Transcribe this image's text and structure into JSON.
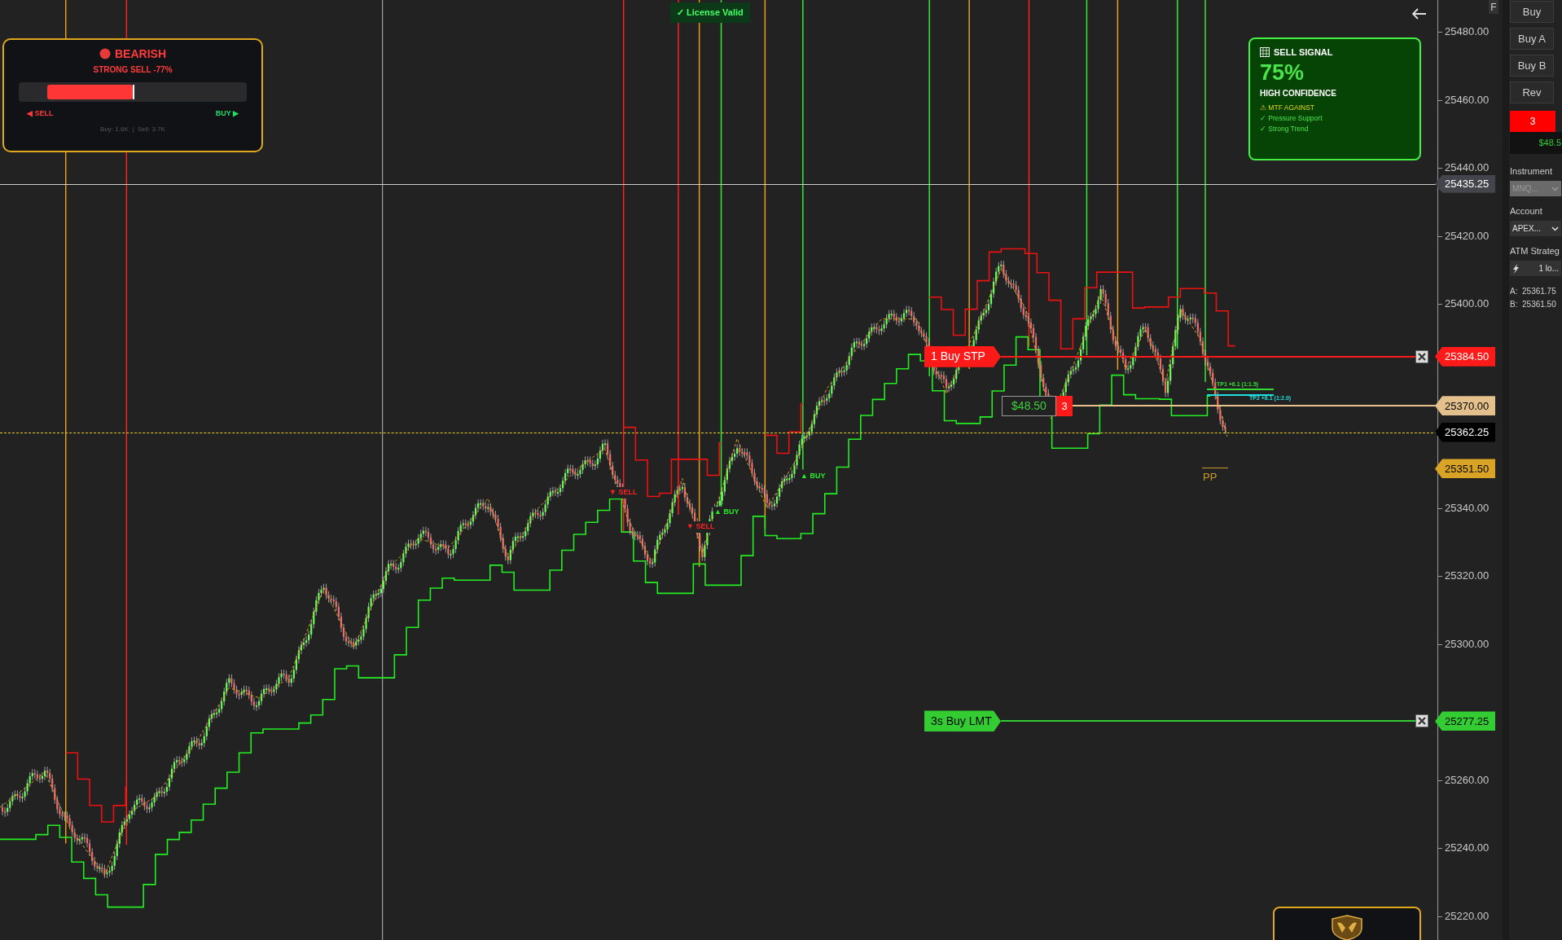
{
  "sentiment_panel": {
    "title": "BEARISH",
    "subtitle": "STRONG SELL -77%",
    "level": 0.75,
    "sell_label": "◀ SELL",
    "buy_label": "BUY ▶",
    "volume": "Buy: 1.6K  |  Sell: 3.7K"
  },
  "license_badge": "✓ License Valid",
  "signal_panel": {
    "title": "SELL SIGNAL",
    "confidence": "75%",
    "confidence_label": "HIGH CONFIDENCE",
    "factors": [
      {
        "text": "⚠ MTF AGAINST",
        "kind": "warning"
      },
      {
        "text": "✓ Pressure Support",
        "kind": "pass"
      },
      {
        "text": "✓ Strong Trend",
        "kind": "pass"
      }
    ]
  },
  "chart_markers": [
    {
      "text": "▼ SELL",
      "kind": "sell"
    },
    {
      "text": "▼ SELL",
      "kind": "sell"
    },
    {
      "text": "▲ BUY",
      "kind": "buy"
    },
    {
      "text": "▲ BUY",
      "kind": "buy"
    }
  ],
  "orders": [
    {
      "label": "1 Buy STP",
      "price": "25384.50",
      "color": "#ff1a1a"
    },
    {
      "label": "3s Buy LMT",
      "price": "25277.25",
      "color": "#33cc33"
    }
  ],
  "position": {
    "pnl": "$48.50",
    "quantity": "3",
    "price": "25370.00"
  },
  "targets": [
    {
      "text": "TP1 +6.1 (1:1.5)",
      "color": "#33dd33"
    },
    {
      "text": "TP2 +8.1 (1:2.0)",
      "color": "#22dddd"
    }
  ],
  "pivot": {
    "label": "PP",
    "price": "25351.50"
  },
  "last_price": "25362.25",
  "crosshair_price": "25435.25",
  "price_axis": {
    "ticks": [
      "25480.00",
      "25460.00",
      "25440.00",
      "25420.00",
      "25400.00",
      "25340.00",
      "25320.00",
      "25300.00",
      "25260.00",
      "25240.00",
      "25220.00"
    ]
  },
  "sidebar": {
    "f_button": "F",
    "buttons": [
      "Buy",
      "Buy A",
      "Buy B",
      "Rev"
    ],
    "position_qty": "3",
    "position_pnl": "$48.5",
    "fields": [
      {
        "label": "Instrument",
        "value": "MNQ...",
        "kind": "select",
        "disabled": true
      },
      {
        "label": "Account",
        "value": "APEX...",
        "kind": "select",
        "disabled": false
      },
      {
        "label": "ATM Strateg",
        "value": "1 lo...",
        "kind": "strategy",
        "disabled": false
      }
    ],
    "ask": "A:  25361.75",
    "bid": "B:  25361.50"
  }
}
